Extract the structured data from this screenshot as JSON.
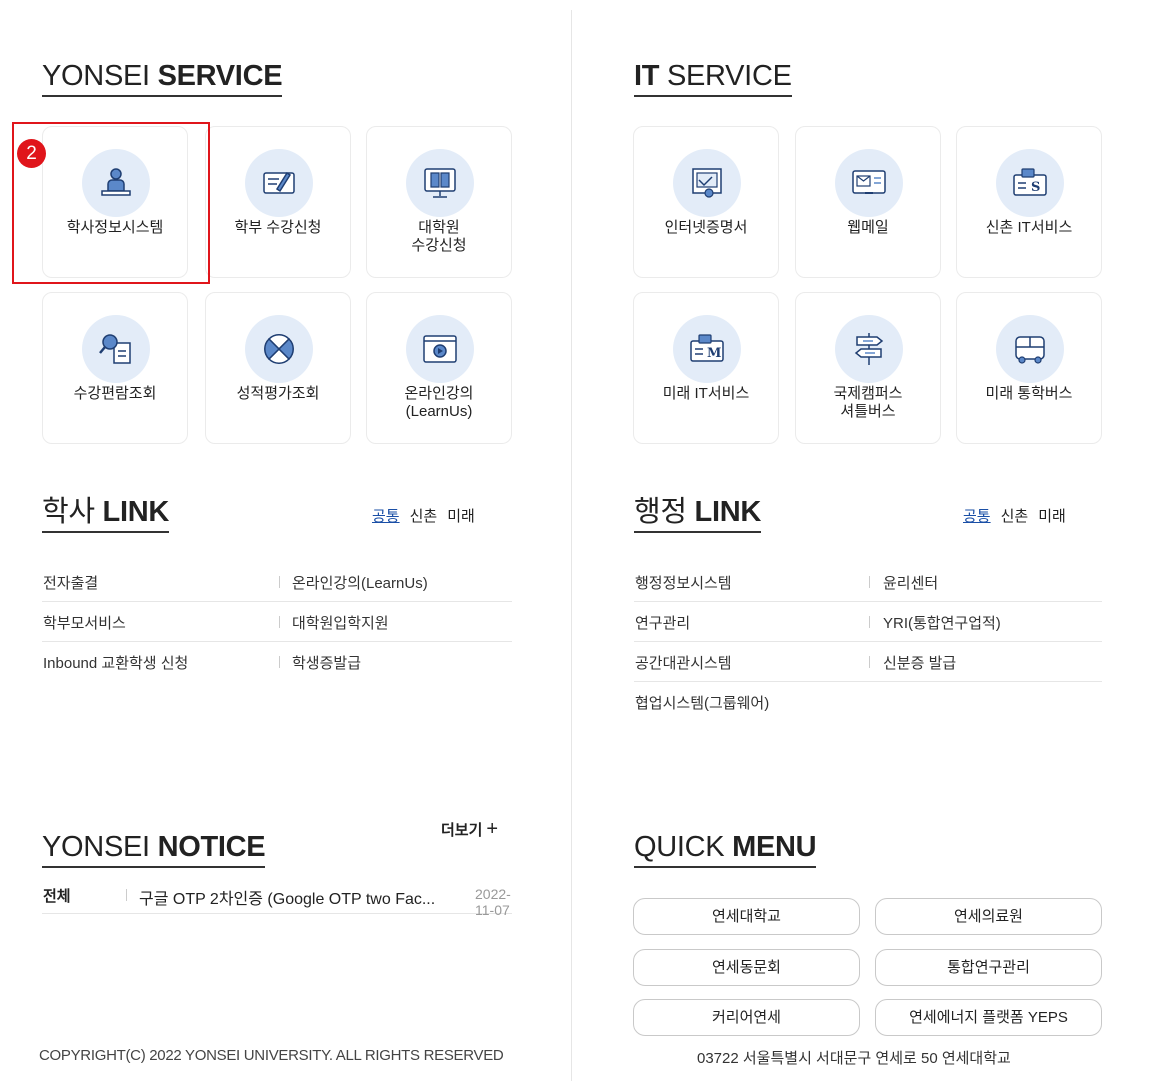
{
  "yonsei_service": {
    "title_light": "YONSEI",
    "title_bold": "SERVICE",
    "cards": [
      {
        "label": "학사정보시스템",
        "icon": "student-desk-icon"
      },
      {
        "label": "학부 수강신청",
        "icon": "signup-pen-icon"
      },
      {
        "label": "대학원\n수강신청",
        "icon": "monitor-book-icon"
      },
      {
        "label": "수강편람조회",
        "icon": "search-document-icon"
      },
      {
        "label": "성적평가조회",
        "icon": "grade-circle-icon"
      },
      {
        "label": "온라인강의\n(LearnUs)",
        "icon": "video-player-icon"
      }
    ],
    "highlight_badge": "2"
  },
  "it_service": {
    "title_bold": "IT",
    "title_light": "SERVICE",
    "cards": [
      {
        "label": "인터넷증명서",
        "icon": "certificate-icon"
      },
      {
        "label": "웹메일",
        "icon": "webmail-icon"
      },
      {
        "label": "신촌 IT서비스",
        "icon": "it-service-s-icon"
      },
      {
        "label": "미래 IT서비스",
        "icon": "it-service-m-icon"
      },
      {
        "label": "국제캠퍼스\n셔틀버스",
        "icon": "signpost-icon"
      },
      {
        "label": "미래 통학버스",
        "icon": "bus-icon"
      }
    ]
  },
  "academic_link": {
    "title_light": "학사",
    "title_bold": "LINK",
    "tabs": [
      "공통",
      "신촌",
      "미래"
    ],
    "rows": [
      [
        "전자출결",
        "온라인강의(LearnUs)"
      ],
      [
        "학부모서비스",
        "대학원입학지원"
      ],
      [
        "Inbound 교환학생 신청",
        "학생증발급"
      ]
    ]
  },
  "admin_link": {
    "title_light": "행정",
    "title_bold": "LINK",
    "tabs": [
      "공통",
      "신촌",
      "미래"
    ],
    "rows": [
      [
        "행정정보시스템",
        "윤리센터"
      ],
      [
        "연구관리",
        "YRI(통합연구업적)"
      ],
      [
        "공간대관시스템",
        "신분증 발급"
      ]
    ],
    "extra": "협업시스템(그룹웨어)"
  },
  "notice": {
    "title_light": "YONSEI",
    "title_bold": "NOTICE",
    "more_label": "더보기",
    "more_symbol": "+",
    "items": [
      {
        "category": "전체",
        "title": "구글 OTP 2차인증 (Google OTP two Fac...",
        "date": "2022-11-07"
      }
    ]
  },
  "quick_menu": {
    "title_light": "QUICK",
    "title_bold": "MENU",
    "buttons": [
      "연세대학교",
      "연세의료원",
      "연세동문회",
      "통합연구관리",
      "커리어연세",
      "연세에너지 플랫폼 YEPS"
    ]
  },
  "footer": {
    "copyright": "COPYRIGHT(C) 2022 YONSEI UNIVERSITY. ALL RIGHTS RESERVED",
    "address": "03722 서울특별시 서대문구 연세로 50 연세대학교"
  },
  "colors": {
    "accent_blue": "#1a4fa6",
    "icon_bg": "#e3ecf8",
    "highlight_red": "#e0151b"
  }
}
